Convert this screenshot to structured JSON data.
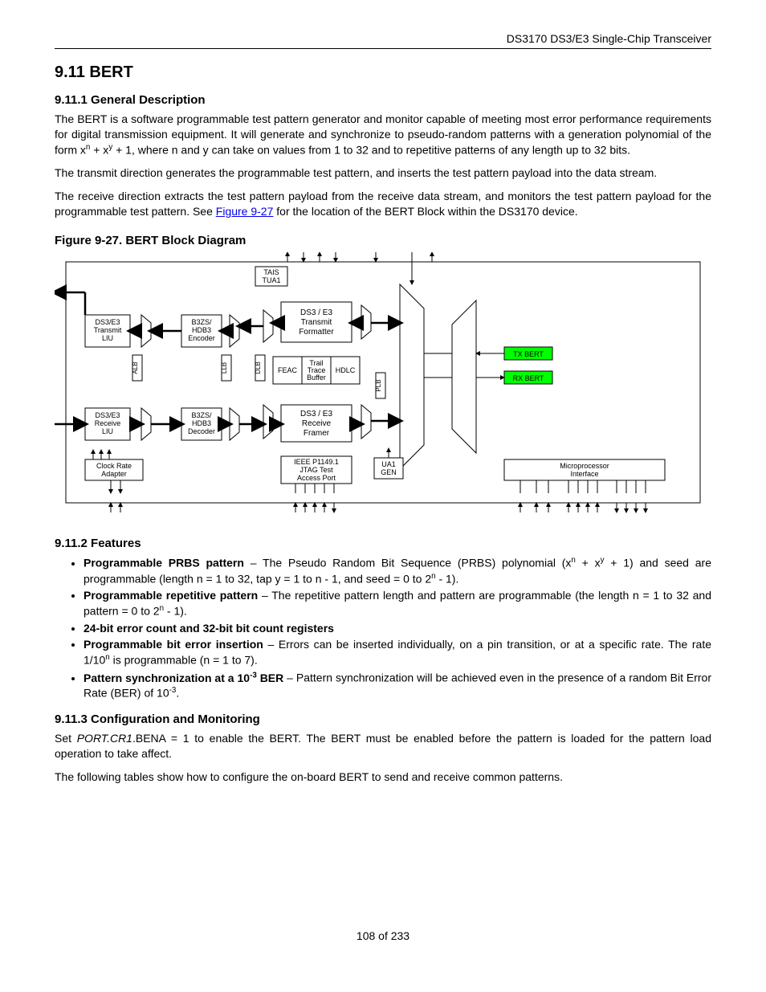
{
  "header": {
    "doc_title": "DS3170 DS3/E3 Single-Chip Transceiver"
  },
  "sec911": {
    "title": "9.11 BERT",
    "s1_title": "9.11.1 General Description",
    "p1a": "The BERT is a software programmable test pattern generator and monitor capable of meeting most error performance requirements for digital transmission equipment. It will generate and synchronize to pseudo-random patterns with a generation polynomial of the form x",
    "p1b": " + x",
    "p1c": " + 1, where n and y can take on values from 1 to 32 and to repetitive patterns of any length up to 32 bits.",
    "p2": "The transmit direction generates the programmable test pattern, and inserts the test pattern payload into the data stream.",
    "p3a": "The receive direction extracts the test pattern payload from the receive data stream, and monitors the test pattern payload for the programmable test pattern. See ",
    "p3_link": "Figure 9-27",
    "p3b": " for the location of the BERT Block within the DS3170 device.",
    "fig_title": "Figure 9-27. BERT Block Diagram",
    "s2_title": "9.11.2 Features",
    "feat": [
      {
        "b": "Programmable PRBS pattern",
        "t1": " – The Pseudo Random Bit Sequence (PRBS) polynomial (x",
        "sn": "n",
        "t2": " + x",
        "sy": "y",
        "t3": " + 1) and seed are programmable (length n = 1 to 32, tap y = 1 to n - 1, and seed = 0 to 2",
        "sn2": "n",
        "t4": " - 1)."
      },
      {
        "b": "Programmable repetitive pattern",
        "t1": " – The repetitive pattern length and pattern are programmable (the length n = 1 to 32 and pattern = 0 to 2",
        "sn": "n",
        "t2": " - 1)."
      },
      {
        "b": "24-bit error count and 32-bit bit count registers",
        "t1": ""
      },
      {
        "b": "Programmable bit error insertion",
        "t1": " – Errors can be inserted individually, on a pin transition, or at a specific rate. The rate 1/10",
        "sn": "n",
        "t2": " is programmable (n = 1 to 7)."
      },
      {
        "b": "Pattern synchronization at a 10",
        "bsup": "-3",
        "b2": " BER",
        "t1": " – Pattern synchronization will be achieved even in the presence of a random Bit Error Rate (BER) of 10",
        "sn": "-3",
        "t2": "."
      }
    ],
    "s3_title": "9.11.3 Configuration and Monitoring",
    "p4a": "Set ",
    "p4_reg": "PORT.CR1",
    "p4b": ".BENA = 1 to enable the BERT. The BERT must be enabled before the pattern is loaded for the pattern load operation to take affect.",
    "p5": "The following tables show how to configure the on-board BERT to send and receive common patterns."
  },
  "diagram": {
    "blocks": {
      "tais": "TAIS",
      "tua1": "TUA1",
      "tx_liu1": "DS3/E3",
      "tx_liu2": "Transmit",
      "tx_liu3": "LIU",
      "tx_enc1": "B3ZS/",
      "tx_enc2": "HDB3",
      "tx_enc3": "Encoder",
      "tx_fmt1": "DS3 / E3",
      "tx_fmt2": "Transmit",
      "tx_fmt3": "Formatter",
      "feac": "FEAC",
      "trail1": "Trail",
      "trail2": "Trace",
      "trail3": "Buffer",
      "hdlc": "HDLC",
      "rx_liu1": "DS3/E3",
      "rx_liu2": "Receive",
      "rx_liu3": "LIU",
      "rx_dec1": "B3ZS/",
      "rx_dec2": "HDB3",
      "rx_dec3": "Decoder",
      "rx_frm1": "DS3 / E3",
      "rx_frm2": "Receive",
      "rx_frm3": "Framer",
      "tx_bert": "TX BERT",
      "rx_bert": "RX BERT",
      "clk1": "Clock Rate",
      "clk2": "Adapter",
      "jtag1": "IEEE P1149.1",
      "jtag2": "JTAG Test",
      "jtag3": "Access Port",
      "ua1a": "UA1",
      "ua1b": "GEN",
      "mpu1": "Microprocessor",
      "mpu2": "Interface",
      "alb": "ALB",
      "llb": "LLB",
      "dlb": "DLB",
      "plb": "PLB"
    }
  },
  "footer": {
    "page": "108 of 233"
  }
}
